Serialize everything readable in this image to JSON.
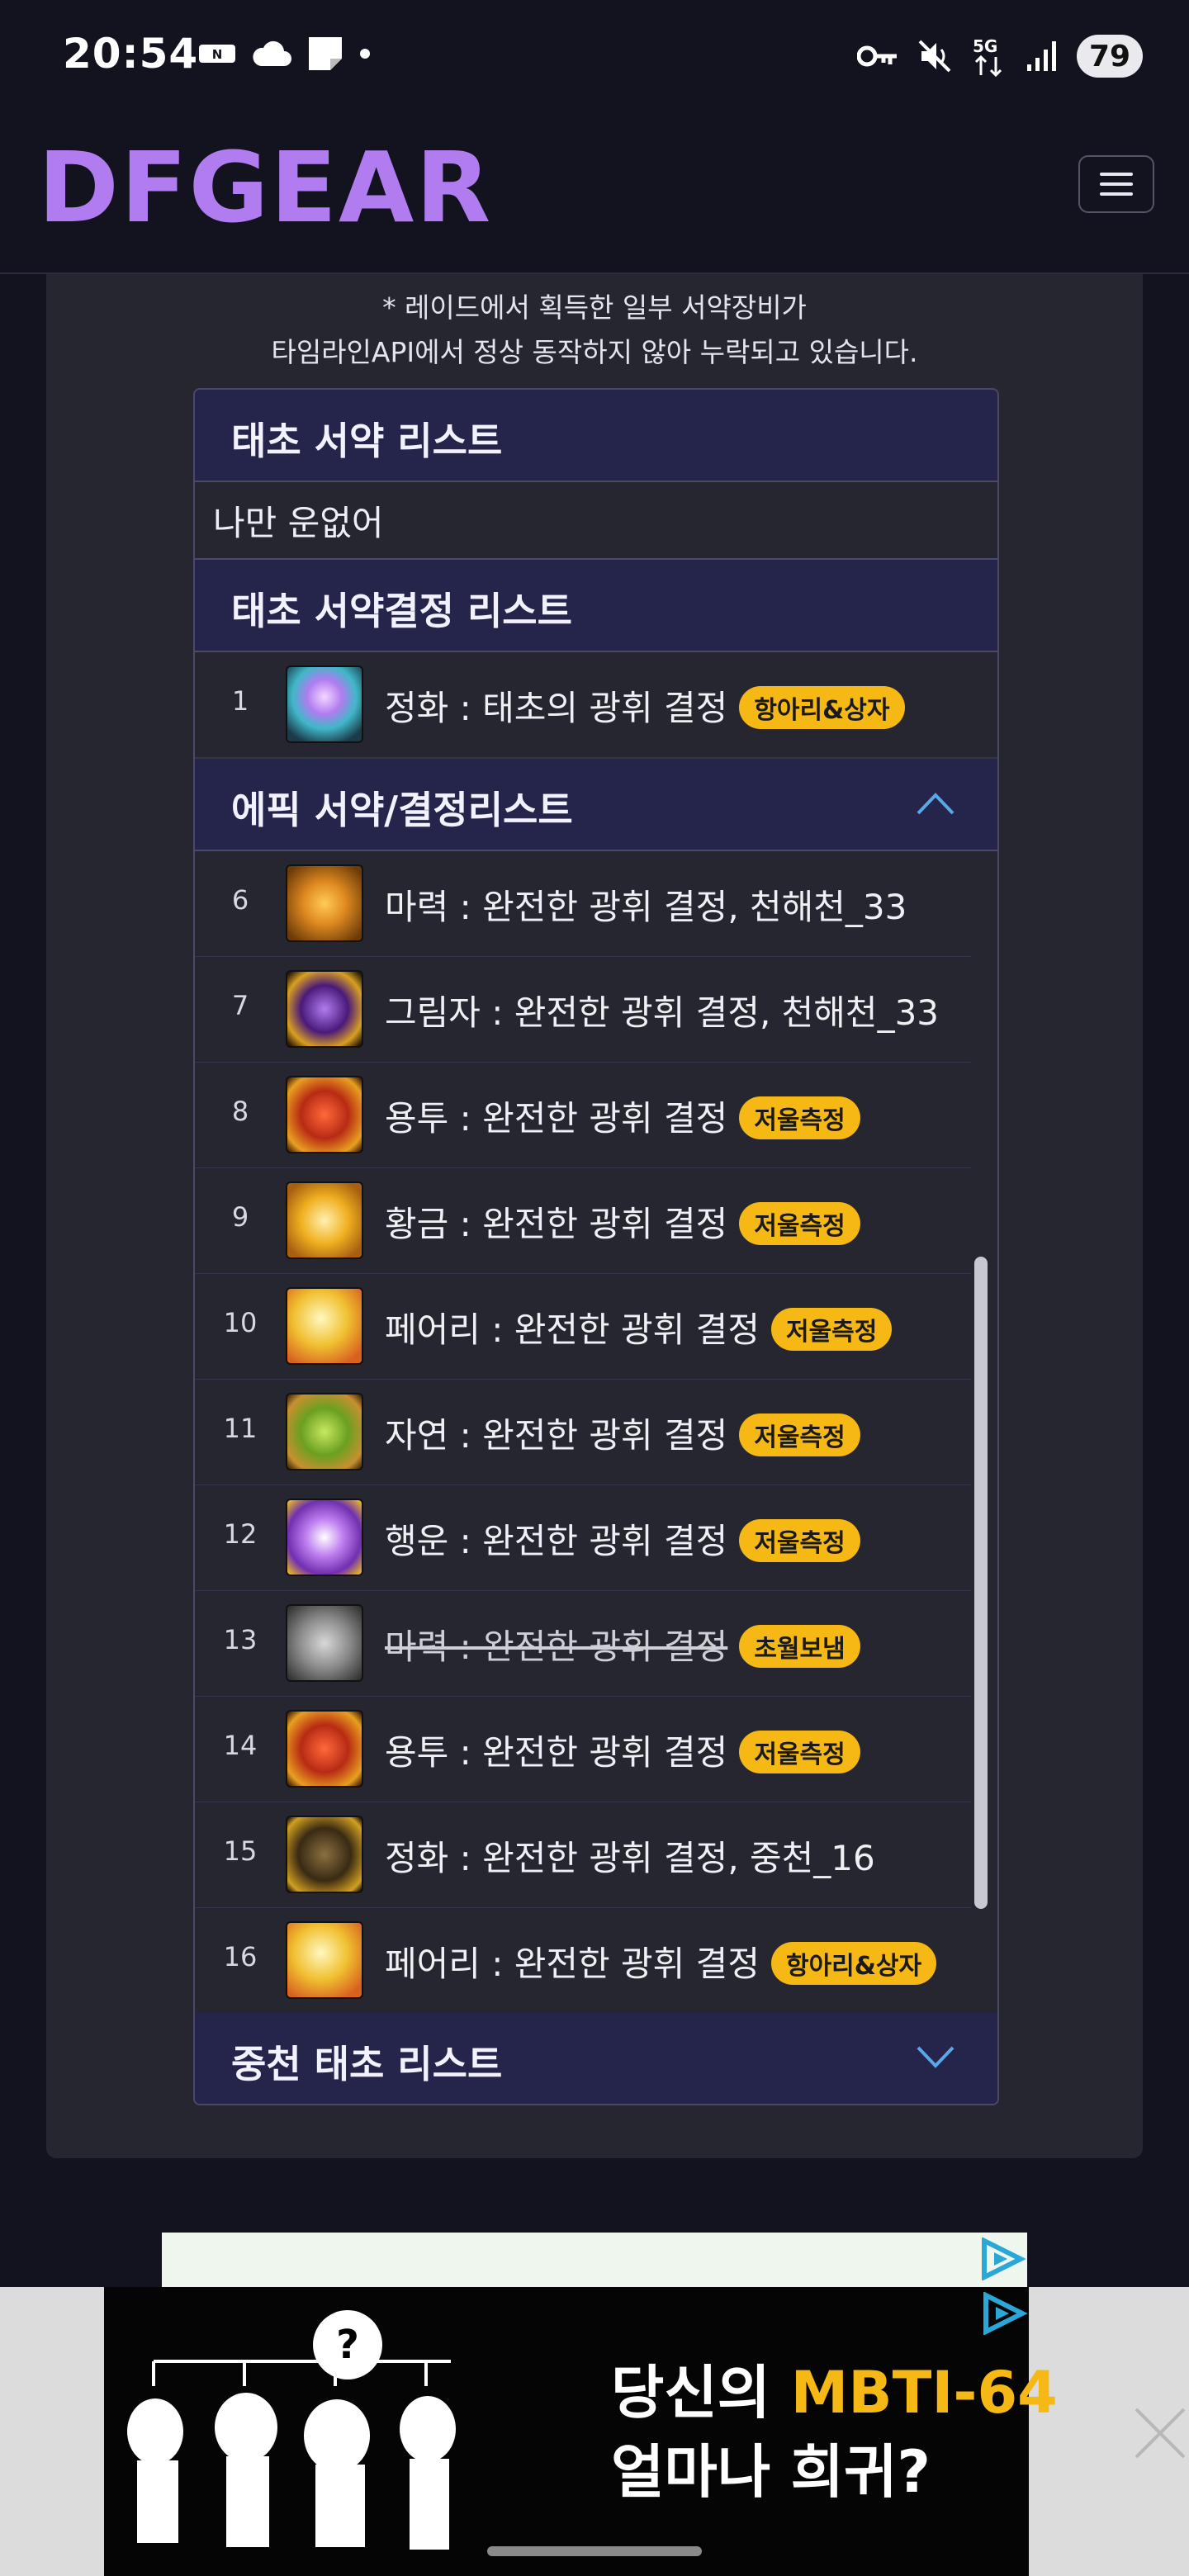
{
  "status_bar": {
    "time": "20:54",
    "battery": "79",
    "network": "5G"
  },
  "header": {
    "logo": "DFGEAR",
    "menu_icon": "hamburger-icon"
  },
  "notice": {
    "line1": "* 레이드에서 획득한 일부 서약장비가",
    "line2": "타임라인API에서 정상 동작하지 않아 누락되고 있습니다."
  },
  "sections": {
    "pact_list": {
      "title": "태초 서약 리스트",
      "empty_text": "나만 운없어"
    },
    "crystal_list": {
      "title": "태초 서약결정 리스트",
      "items": [
        {
          "num": "1",
          "name": "정화 : 태초의 광휘 결정",
          "tag": "항아리&상자"
        }
      ]
    },
    "epic_list": {
      "title": "에픽 서약/결정리스트",
      "expanded": true,
      "items": [
        {
          "num": "6",
          "name": "마력 : 완전한 광휘 결정, 천해천_33",
          "tag": ""
        },
        {
          "num": "7",
          "name": "그림자 : 완전한 광휘 결정, 천해천_33",
          "tag": ""
        },
        {
          "num": "8",
          "name": "용투 : 완전한 광휘 결정",
          "tag": "저울측정"
        },
        {
          "num": "9",
          "name": "황금 : 완전한 광휘 결정",
          "tag": "저울측정"
        },
        {
          "num": "10",
          "name": "페어리 : 완전한 광휘 결정",
          "tag": "저울측정"
        },
        {
          "num": "11",
          "name": "자연 : 완전한 광휘 결정",
          "tag": "저울측정"
        },
        {
          "num": "12",
          "name": "행운 : 완전한 광휘 결정",
          "tag": "저울측정"
        },
        {
          "num": "13",
          "name": "마력 : 완전한 광휘 결정",
          "tag": "초월보냄",
          "struck": true
        },
        {
          "num": "14",
          "name": "용투 : 완전한 광휘 결정",
          "tag": "저울측정"
        },
        {
          "num": "15",
          "name": "정화 : 완전한 광휘 결정, 중천_16",
          "tag": ""
        },
        {
          "num": "16",
          "name": "페어리 : 완전한 광휘 결정",
          "tag": "항아리&상자"
        }
      ]
    },
    "mid_list": {
      "title": "중천 태초 리스트",
      "expanded": false
    }
  },
  "ad": {
    "text_line1_prefix": "당신의 ",
    "text_line1_highlight": "MBTI-64",
    "text_line2": "얼마나 희귀?"
  },
  "colors": {
    "background": "#13131f",
    "card": "#262631",
    "section_header": "#25244a",
    "logo": "#b07cf0",
    "tag": "#f5b814"
  }
}
